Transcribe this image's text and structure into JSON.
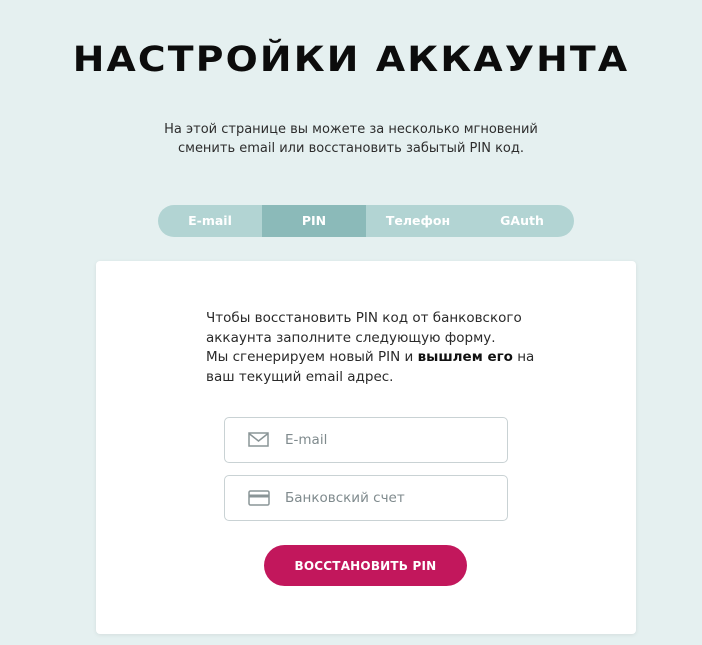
{
  "header": {
    "title": "НАСТРОЙКИ АККАУНТА",
    "subtitle": "На этой странице вы можете за несколько мгновений сменить email или восстановить забытый PIN код."
  },
  "tabs": [
    {
      "label": "E-mail",
      "active": false
    },
    {
      "label": "PIN",
      "active": true
    },
    {
      "label": "Телефон",
      "active": false
    },
    {
      "label": "GAuth",
      "active": false
    }
  ],
  "form": {
    "description_line1": "Чтобы восстановить PIN код от банковского аккаунта заполните следующую форму.",
    "description_pre": "Мы сгенерируем новый PIN и ",
    "description_bold": "вышлем его",
    "description_post": " на ваш текущий email адрес.",
    "email_field": {
      "placeholder": "E-mail",
      "value": "",
      "icon": "envelope-icon"
    },
    "account_field": {
      "placeholder": "Банковский счет",
      "value": "",
      "icon": "card-icon"
    },
    "submit_label": "ВОССТАНОВИТЬ PIN"
  },
  "colors": {
    "background": "#e5f0f0",
    "tab_bg": "#b2d4d3",
    "tab_active": "#8bbab9",
    "accent": "#c2175c"
  }
}
